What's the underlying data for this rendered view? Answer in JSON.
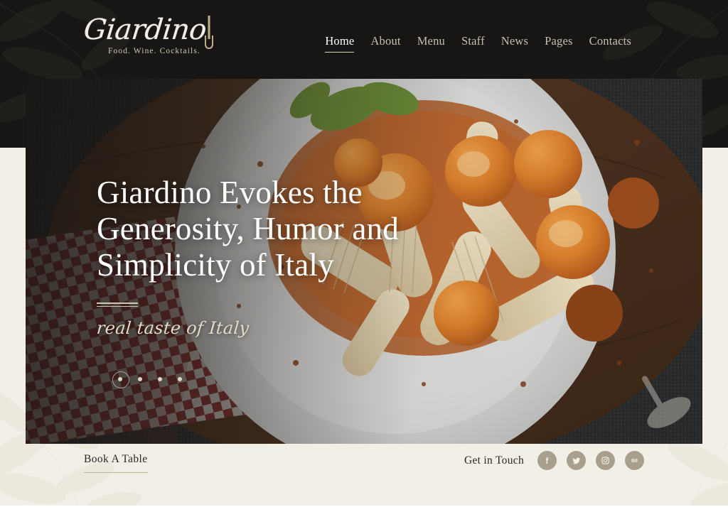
{
  "brand": {
    "name": "Giardino",
    "tagline": "Food. Wine. Cocktails.",
    "fork_icon": "fork-icon"
  },
  "nav": {
    "items": [
      {
        "label": "Home",
        "active": true
      },
      {
        "label": "About",
        "active": false
      },
      {
        "label": "Menu",
        "active": false
      },
      {
        "label": "Staff",
        "active": false
      },
      {
        "label": "News",
        "active": false
      },
      {
        "label": "Pages",
        "active": false
      },
      {
        "label": "Contacts",
        "active": false
      }
    ]
  },
  "hero": {
    "title": "Giardino Evokes the Generosity, Humor and Simplicity of Italy",
    "tagline": "real taste of Italy",
    "image_alt": "penne pasta with cherry tomatoes and basil on a white plate",
    "slider": {
      "total": 4,
      "active_index": 0
    }
  },
  "footer": {
    "book_label": "Book A Table",
    "touch_label": "Get in Touch",
    "social": [
      {
        "name": "facebook-icon",
        "label": "f"
      },
      {
        "name": "twitter-icon",
        "label": "t"
      },
      {
        "name": "instagram-icon",
        "label": "ig"
      },
      {
        "name": "behance-icon",
        "label": "Be"
      }
    ]
  },
  "colors": {
    "header_bg": "#171614",
    "cream_bg": "#f2efe6",
    "accent_tan": "#c8bfae",
    "social_circle": "#a8a08c",
    "text_dark": "#2a2723",
    "hero_title": "#ffffff"
  }
}
